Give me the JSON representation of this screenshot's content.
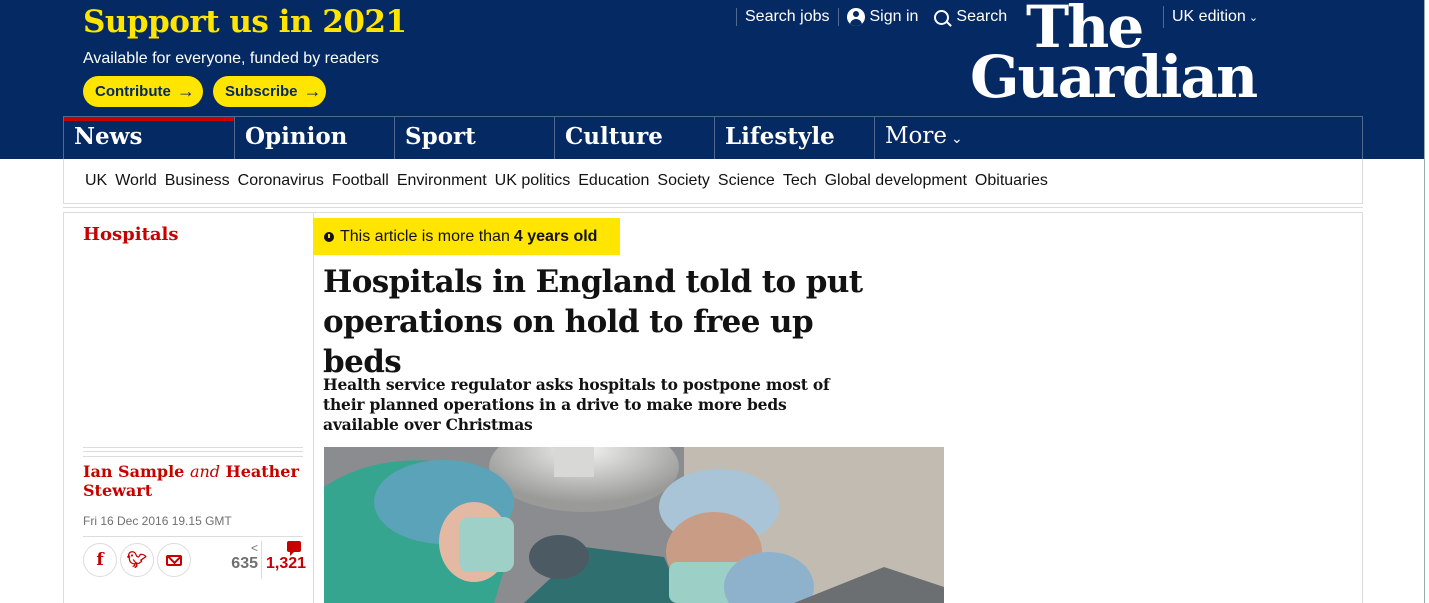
{
  "support": {
    "title": "Support us in 2021",
    "subtitle": "Available for everyone, funded by readers",
    "contribute_label": "Contribute",
    "subscribe_label": "Subscribe"
  },
  "top_links": {
    "search_jobs": "Search jobs",
    "sign_in": "Sign in",
    "search": "Search",
    "edition": "UK edition"
  },
  "logo": {
    "line1": "The",
    "line2": "Guardian"
  },
  "pillars": [
    {
      "label": "News"
    },
    {
      "label": "Opinion"
    },
    {
      "label": "Sport"
    },
    {
      "label": "Culture"
    },
    {
      "label": "Lifestyle"
    },
    {
      "label": "More"
    }
  ],
  "subnav": [
    "UK",
    "World",
    "Business",
    "Coronavirus",
    "Football",
    "Environment",
    "UK politics",
    "Education",
    "Society",
    "Science",
    "Tech",
    "Global development",
    "Obituaries"
  ],
  "article": {
    "section": "Hospitals",
    "age_prefix": "This article is more than",
    "age_value": "4 years old",
    "headline": "Hospitals in England told to put operations on hold to free up beds",
    "standfirst": "Health service regulator asks hospitals to postpone most of their planned operations in a drive to make more beds available over Christmas",
    "author1": "Ian Sample",
    "and": "and",
    "author2": "Heather Stewart",
    "date": "Fri 16 Dec 2016 19.15 GMT",
    "share_count": "635",
    "comment_count": "1,321"
  },
  "colors": {
    "brand_blue": "#052962",
    "accent_yellow": "#ffe500",
    "news_red": "#c70000"
  },
  "icons": {
    "user": "user-icon",
    "search": "search-icon",
    "chevron": "chevron-down-icon",
    "clock": "clock-icon",
    "facebook": "facebook-icon",
    "twitter": "twitter-icon",
    "email": "email-icon",
    "share": "share-icon",
    "comment": "comment-icon"
  }
}
